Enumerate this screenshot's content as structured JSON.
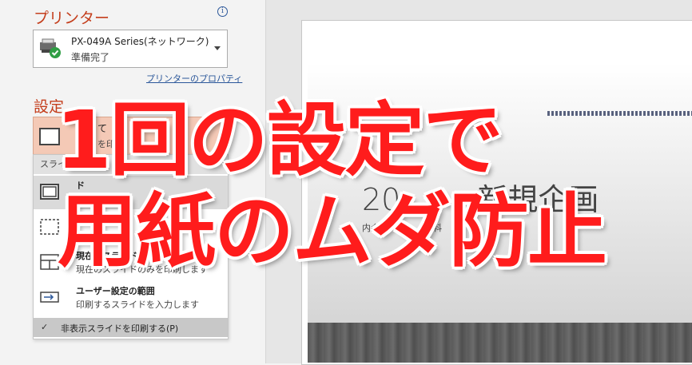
{
  "printer_section": {
    "title": "プリンター",
    "info_icon": "i",
    "printer_name": "PX-049A Series(ネットワーク)",
    "printer_status": "準備完了",
    "properties_link": "プリンターのプロパティ"
  },
  "settings_section": {
    "title": "設定",
    "selected_line1": "て",
    "selected_line2": "を印"
  },
  "dropdown": {
    "header": "スライド",
    "options": [
      {
        "title": "ド",
        "desc": "す"
      },
      {
        "title": "",
        "desc": ""
      },
      {
        "title": "現在のスライドを印刷",
        "desc": "現在のスライドのみを印刷します"
      },
      {
        "title": "ユーザー設定の範囲",
        "desc": "印刷するスライドを入力します"
      }
    ],
    "hidden_check": "✓",
    "hidden_label": "非表示スライドを印刷する(P)"
  },
  "preview": {
    "slide_title": "20",
    "slide_title_right": "新規企画",
    "slide_sub": "内会議",
    "slide_sub_right": "料"
  },
  "overlay": {
    "line1": "1回の設定で",
    "line2": "用紙のムダ防止"
  },
  "colors": {
    "accent": "#c43e1c",
    "overlay_red": "#ff1c1c",
    "link": "#2b579a",
    "check_green": "#2f9e44"
  }
}
